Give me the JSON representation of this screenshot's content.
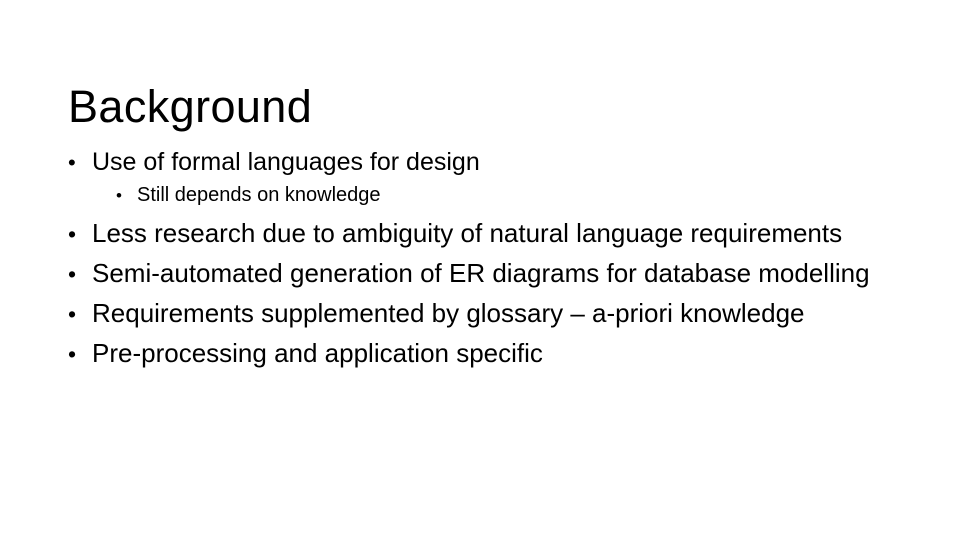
{
  "slide": {
    "title": "Background",
    "background_color": "#ffffff",
    "text_color": "#000000",
    "bullet_glyph": "•",
    "content": [
      {
        "level": 1,
        "size": "small",
        "text": "Use of formal languages for design"
      },
      {
        "level": 2,
        "size": "sub",
        "text": "Still depends on knowledge"
      },
      {
        "level": 1,
        "size": "large",
        "text": "Less research due to ambiguity of natural language requirements"
      },
      {
        "level": 1,
        "size": "large",
        "text": "Semi-automated generation of ER diagrams for database modelling"
      },
      {
        "level": 1,
        "size": "large",
        "text": "Requirements supplemented by glossary – a-priori knowledge"
      },
      {
        "level": 1,
        "size": "large",
        "text": "Pre-processing and application specific"
      }
    ]
  }
}
